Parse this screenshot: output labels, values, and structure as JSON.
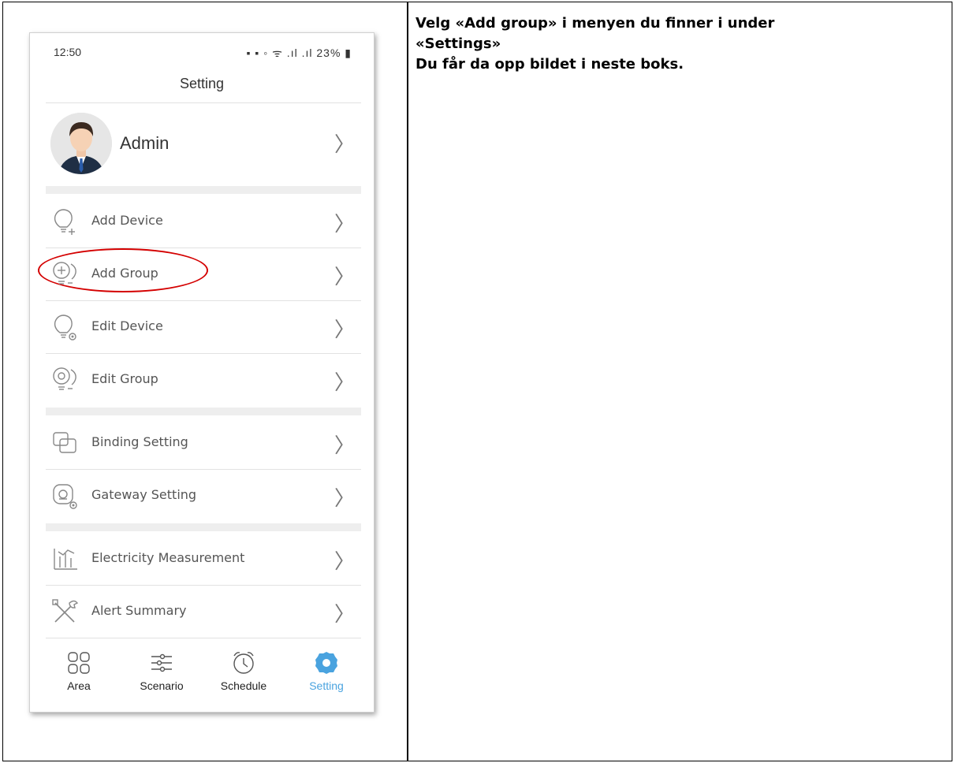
{
  "instructions": {
    "line1": "Velg «Add group» i menyen du finner i under",
    "line2": "«Settings»",
    "line3": "Du får da opp bildet i neste boks."
  },
  "phone": {
    "status": {
      "time": "12:50",
      "right_text": "23%"
    },
    "screen_title": "Setting",
    "profile": {
      "name": "Admin"
    },
    "menu_group_1": [
      {
        "label": "Add Device",
        "icon": "bulb-plus-icon"
      },
      {
        "label": "Add Group",
        "icon": "group-plus-icon"
      },
      {
        "label": "Edit Device",
        "icon": "bulb-gear-icon"
      },
      {
        "label": "Edit Group",
        "icon": "group-gear-icon"
      }
    ],
    "menu_group_2": [
      {
        "label": "Binding Setting",
        "icon": "binding-icon"
      },
      {
        "label": "Gateway Setting",
        "icon": "gateway-icon"
      }
    ],
    "menu_group_3": [
      {
        "label": "Electricity Measurement",
        "icon": "chart-icon"
      },
      {
        "label": "Alert Summary",
        "icon": "tools-icon"
      }
    ],
    "tabs": [
      {
        "label": "Area",
        "icon": "grid-icon",
        "active": false
      },
      {
        "label": "Scenario",
        "icon": "sliders-icon",
        "active": false
      },
      {
        "label": "Schedule",
        "icon": "alarm-clock-icon",
        "active": false
      },
      {
        "label": "Setting",
        "icon": "gear-icon",
        "active": true
      }
    ],
    "colors": {
      "accent": "#4aa3df",
      "highlight": "#d40000"
    }
  }
}
